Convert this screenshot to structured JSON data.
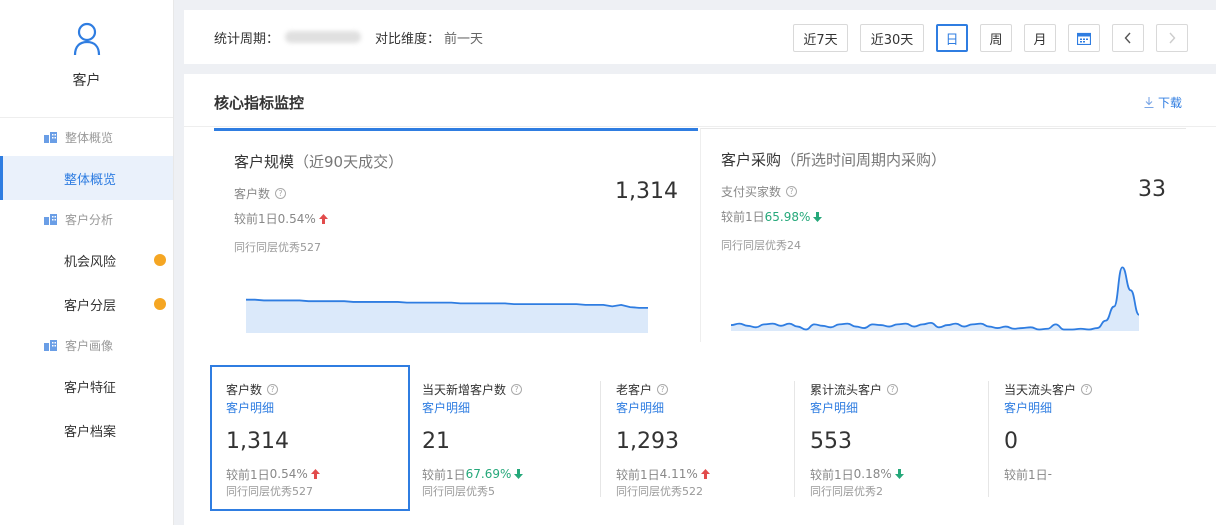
{
  "sidebar": {
    "user_label": "客户",
    "groups": [
      {
        "label": "整体概览",
        "items": [
          {
            "label": "整体概览",
            "active": true,
            "dot": false
          }
        ]
      },
      {
        "label": "客户分析",
        "items": [
          {
            "label": "机会风险",
            "dot": true
          },
          {
            "label": "客户分层",
            "dot": true
          }
        ]
      },
      {
        "label": "客户画像",
        "items": [
          {
            "label": "客户特征",
            "dot": false
          },
          {
            "label": "客户档案",
            "dot": false
          }
        ]
      }
    ]
  },
  "topbar": {
    "period_label": "统计周期：",
    "compare_label": "对比维度：",
    "compare_value": "前一天",
    "buttons": {
      "last7": "近7天",
      "last30": "近30天",
      "day": "日",
      "week": "周",
      "month": "月"
    }
  },
  "panel": {
    "title": "核心指标监控",
    "download": "下载"
  },
  "cards": [
    {
      "title": "客户规模",
      "title_paren": "（近90天成交）",
      "metric_label": "客户数",
      "value": "1,314",
      "compare_prefix": "较前1日",
      "compare_value": "0.54%",
      "trend": "up",
      "peer": "同行同层优秀527",
      "chart": [
        0.45,
        0.45,
        0.44,
        0.44,
        0.44,
        0.44,
        0.44,
        0.43,
        0.43,
        0.43,
        0.43,
        0.43,
        0.42,
        0.42,
        0.42,
        0.42,
        0.42,
        0.42,
        0.41,
        0.41,
        0.41,
        0.41,
        0.41,
        0.41,
        0.4,
        0.4,
        0.4,
        0.4,
        0.4,
        0.4,
        0.39,
        0.39,
        0.39,
        0.39,
        0.39,
        0.39,
        0.39,
        0.39,
        0.38,
        0.38,
        0.38,
        0.36,
        0.38,
        0.35,
        0.34,
        0.34
      ]
    },
    {
      "title": "客户采购",
      "title_paren": "（所选时间周期内采购）",
      "metric_label": "支付买家数",
      "value": "33",
      "compare_prefix": "较前1日",
      "compare_value": "65.98%",
      "trend": "down",
      "peer": "同行同层优秀24",
      "chart": [
        0.08,
        0.1,
        0.07,
        0.05,
        0.09,
        0.1,
        0.07,
        0.1,
        0.06,
        0.02,
        0.09,
        0.07,
        0.05,
        0.09,
        0.1,
        0.06,
        0.04,
        0.09,
        0.08,
        0.06,
        0.09,
        0.1,
        0.06,
        0.09,
        0.11,
        0.05,
        0.08,
        0.1,
        0.06,
        0.09,
        0.1,
        0.06,
        0.04,
        0.06,
        0.03,
        0.04,
        0.05,
        0.02,
        0.03,
        0.09,
        0.02,
        0.02,
        0.03,
        0.02,
        0.04,
        0.14,
        0.33,
        0.86,
        0.55,
        0.22
      ]
    }
  ],
  "kpis": [
    {
      "name": "客户数",
      "link": "客户明细",
      "value": "1,314",
      "compare_prefix": "较前1日",
      "compare_value": "0.54%",
      "trend": "up",
      "peer": "同行同层优秀527",
      "selected": true
    },
    {
      "name": "当天新增客户数",
      "link": "客户明细",
      "value": "21",
      "compare_prefix": "较前1日",
      "compare_value": "67.69%",
      "trend": "down",
      "peer": "同行同层优秀5",
      "selected": false
    },
    {
      "name": "老客户",
      "link": "客户明细",
      "value": "1,293",
      "compare_prefix": "较前1日",
      "compare_value": "4.11%",
      "trend": "up",
      "peer": "同行同层优秀522",
      "selected": false
    },
    {
      "name": "累计流头客户",
      "link": "客户明细",
      "value": "553",
      "compare_prefix": "较前1日",
      "compare_value": "0.18%",
      "trend": "down",
      "peer": "同行同层优秀2",
      "selected": false
    },
    {
      "name": "当天流头客户",
      "link": "客户明细",
      "value": "0",
      "compare_prefix": "较前1日",
      "compare_value": "-",
      "trend": "none",
      "peer": "",
      "selected": false
    }
  ],
  "colors": {
    "accent": "#2f7de1",
    "up": "#e24c4c",
    "down": "#25a87a",
    "dot": "#f5a623",
    "chart_fill": "#dbe9fa"
  }
}
